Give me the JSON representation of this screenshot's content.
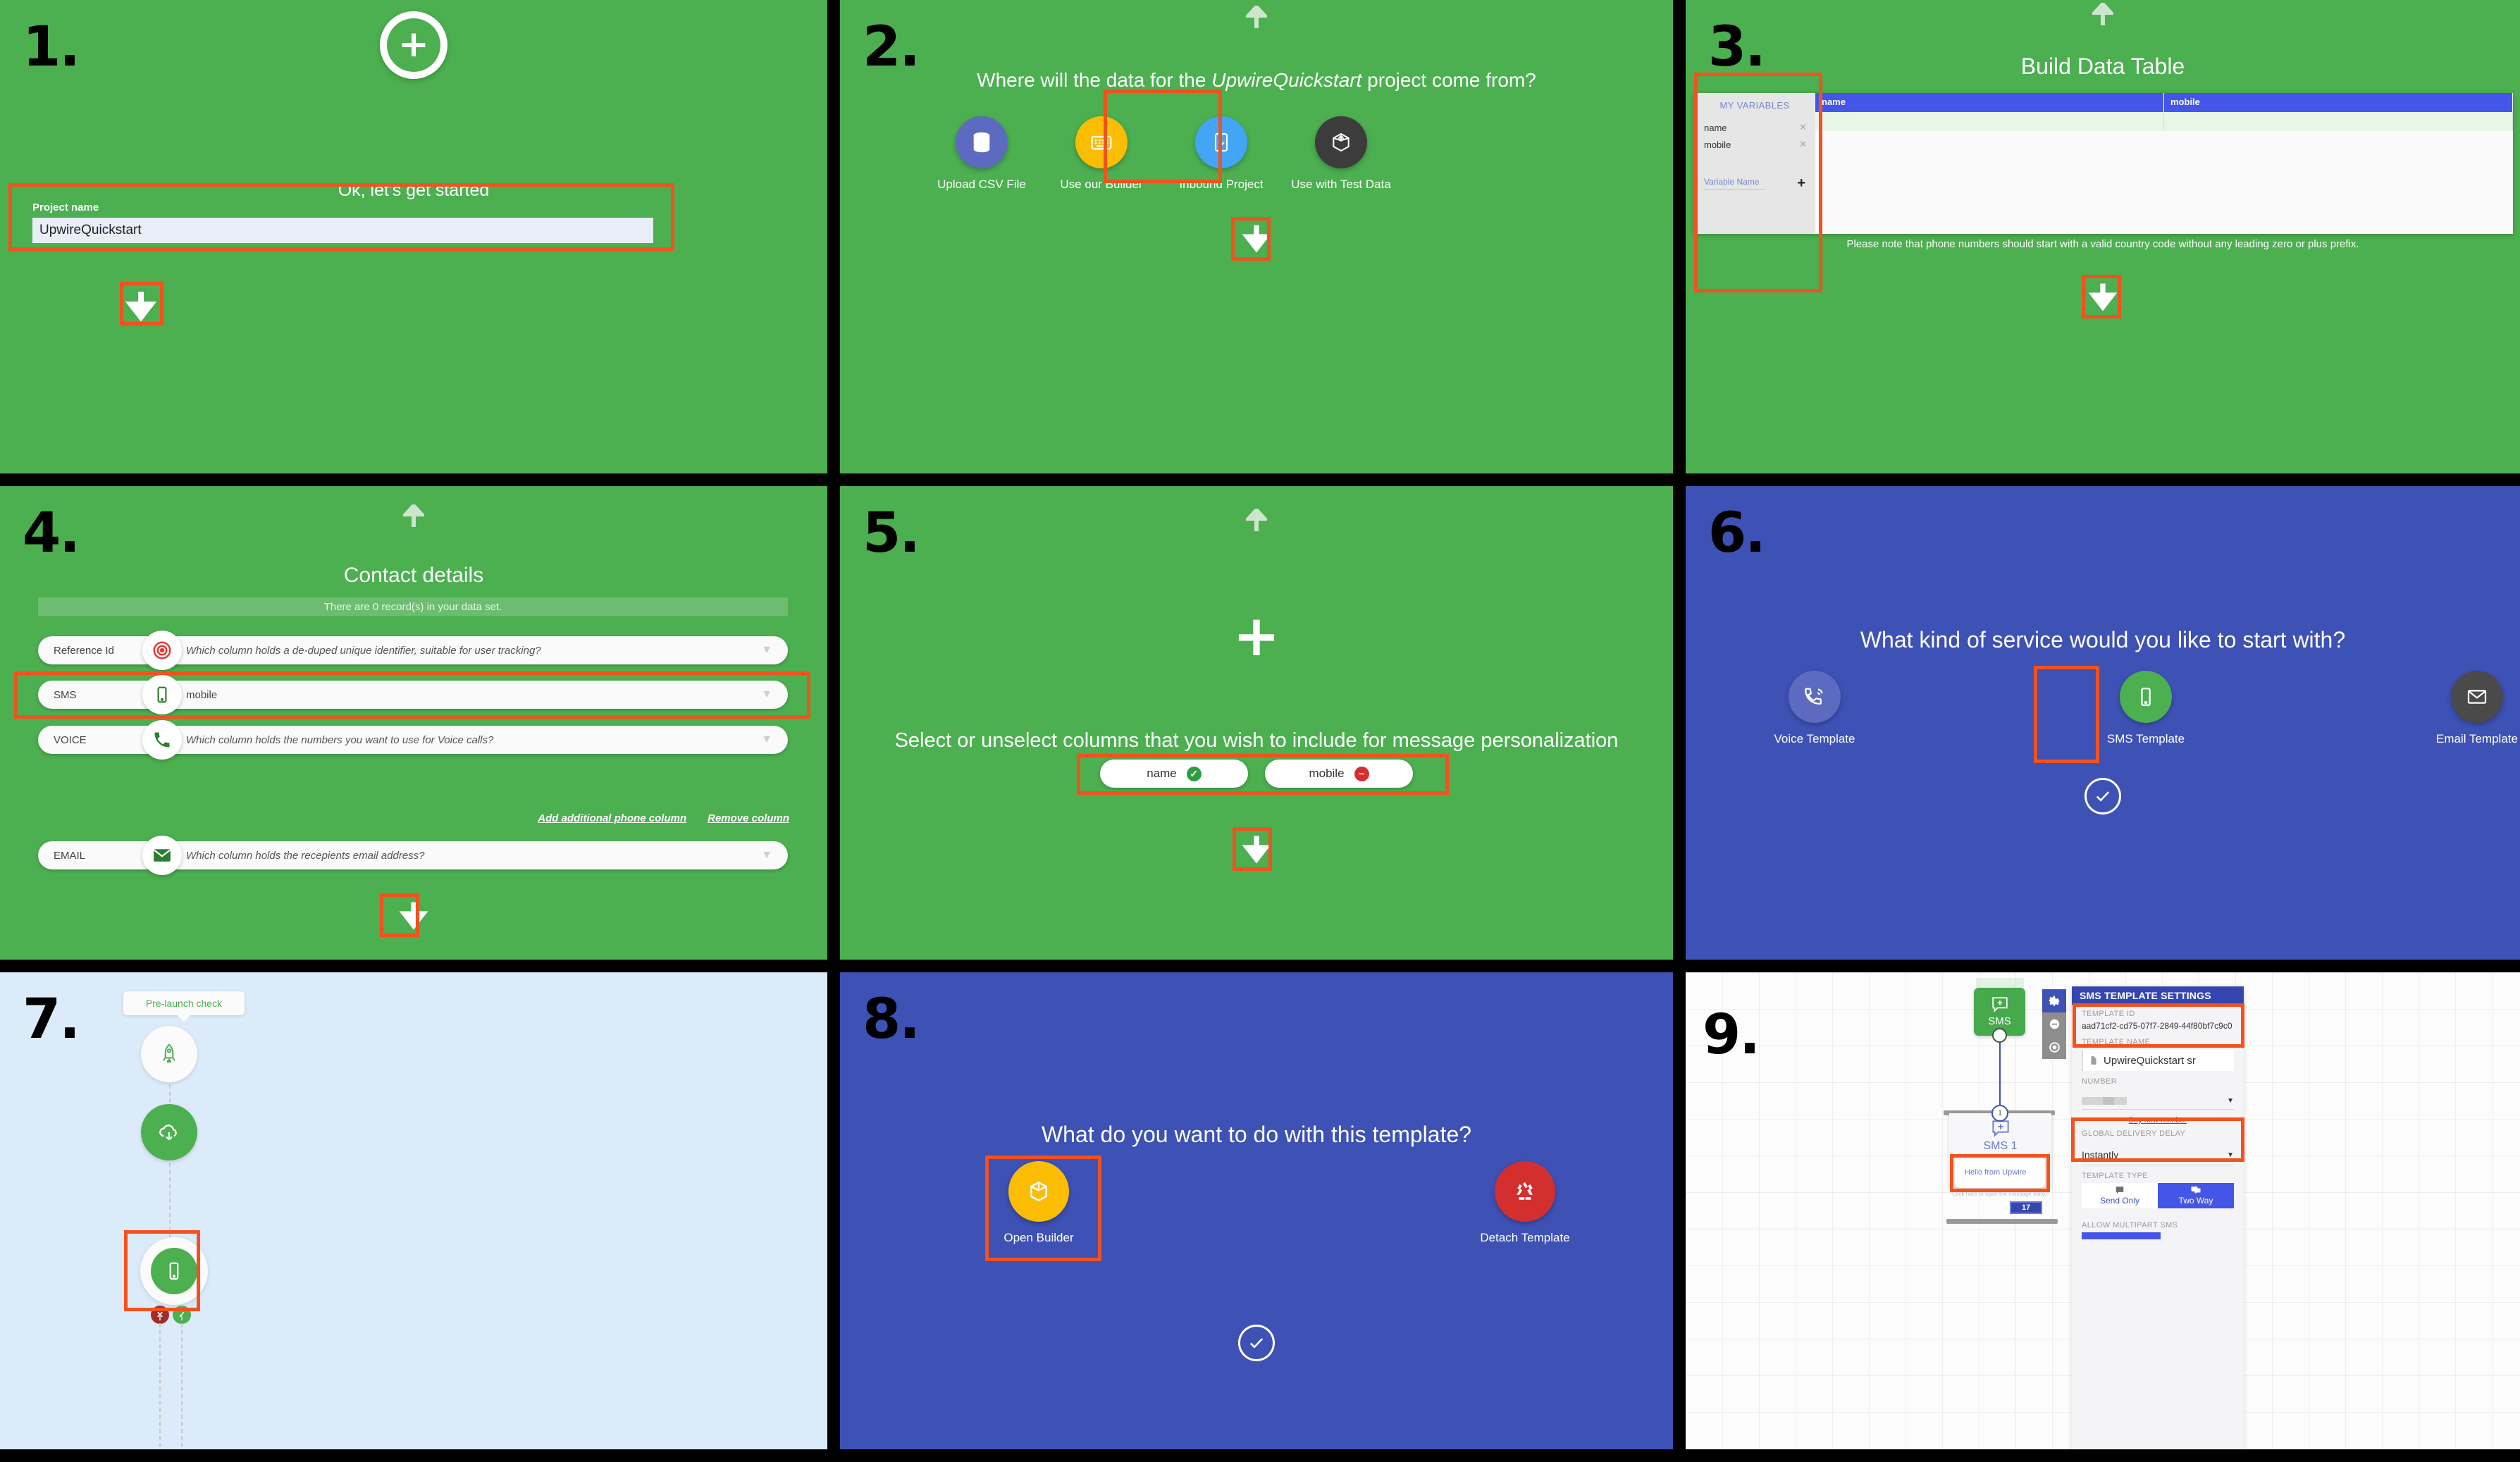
{
  "panels": {
    "p1": {
      "number": "1.",
      "title": "Ok, let's get started",
      "field_label": "Project name",
      "field_value": "UpwireQuickstart"
    },
    "p2": {
      "number": "2.",
      "question_pre": "Where will the data for the ",
      "question_em": "UpwireQuickstart",
      "question_post": " project come from?",
      "options": [
        {
          "label": "Upload CSV File",
          "icon": "database-icon",
          "color": "#5C6BC0"
        },
        {
          "label": "Use our Builder",
          "icon": "keyboard-icon",
          "color": "#FBBC04"
        },
        {
          "label": "Inbound Project",
          "icon": "inbound-download-icon",
          "color": "#42A5F5"
        },
        {
          "label": "Use with Test Data",
          "icon": "test-box-icon",
          "color": "#3C3C3C"
        }
      ]
    },
    "p3": {
      "number": "3.",
      "title": "Build Data Table",
      "variables_header": "MY VARIABLES",
      "variables": [
        "name",
        "mobile"
      ],
      "new_variable_placeholder": "Variable Name",
      "add_symbol": "+",
      "columns": [
        "name",
        "mobile"
      ],
      "note": "Please note that phone numbers should start with a valid country code without any leading zero or plus prefix."
    },
    "p4": {
      "number": "4.",
      "title": "Contact details",
      "record_banner": "There are 0 record(s) in your data set.",
      "rows": [
        {
          "key": "Reference Id",
          "value": "Which column holds a de-duped unique identifier, suitable for user tracking?",
          "icon": "target-icon",
          "solid": false
        },
        {
          "key": "SMS",
          "value": "mobile",
          "icon": "mobile-icon",
          "solid": true
        },
        {
          "key": "VOICE",
          "value": "Which column holds the numbers you want to use for Voice calls?",
          "icon": "phone-icon",
          "solid": false
        },
        {
          "key": "EMAIL",
          "value": "Which column holds the recepients email address?",
          "icon": "envelope-icon",
          "solid": false
        }
      ],
      "links": [
        "Add additional phone column",
        "Remove column"
      ]
    },
    "p5": {
      "number": "5.",
      "plus": "+",
      "instruction": "Select or unselect columns that you wish to include for message personalization",
      "chips": [
        {
          "label": "name",
          "state": "selected",
          "badge": "✓",
          "badge_color": "#2E9E44"
        },
        {
          "label": "mobile",
          "state": "unselected",
          "badge": "−",
          "badge_color": "#D32F2F"
        }
      ]
    },
    "p6": {
      "number": "6.",
      "question": "What kind of service would you like to start with?",
      "options": [
        {
          "label": "Voice Template",
          "icon": "voice-call-icon",
          "color": "#5C6BC0"
        },
        {
          "label": "SMS Template",
          "icon": "mobile-icon",
          "color": "#4CAF50"
        },
        {
          "label": "Email Template",
          "icon": "envelope-icon",
          "color": "#4A4A4A"
        }
      ],
      "confirm": "✓"
    },
    "p7": {
      "number": "7.",
      "tooltip": "Pre-launch check",
      "nodes": [
        {
          "name": "rocket-node",
          "icon": "rocket-icon"
        },
        {
          "name": "cloud-download-node",
          "icon": "cloud-download-icon"
        },
        {
          "name": "sms-node",
          "icon": "mobile-icon"
        }
      ],
      "branch_badges": [
        {
          "label": "✕",
          "color": "#A52A2A"
        },
        {
          "label": "✓",
          "color": "#4CAF50"
        }
      ]
    },
    "p8": {
      "number": "8.",
      "question": "What do you want to do with this template?",
      "options": [
        {
          "label": "Open Builder",
          "icon": "box-cube-icon",
          "color": "#FBBC04"
        },
        {
          "label": "Detach Template",
          "icon": "recycle-icon",
          "color": "#D32F2F"
        }
      ],
      "confirm": "✓"
    },
    "p9": {
      "number": "9.",
      "node_label": "SMS",
      "connector_number": "1",
      "card_label": "SMS 1",
      "message_text": "Hello from Upwire",
      "message_hint": "Click here to open the message editor.",
      "char_badge": "17",
      "tools": [
        {
          "name": "gear-icon",
          "glyph": "⚙",
          "active": true
        },
        {
          "name": "minus-circle-icon",
          "glyph": "⊖",
          "active": false
        },
        {
          "name": "record-circle-icon",
          "glyph": "◉",
          "active": false
        }
      ],
      "settings": {
        "header": "SMS TEMPLATE SETTINGS",
        "template_id_label": "TEMPLATE ID",
        "template_id_value": "aad71cf2-cd75-07f7-2849-44f80bf7c9c0",
        "template_name_label": "TEMPLATE NAME",
        "template_name_value": "UpwireQuickstart sr",
        "number_label": "NUMBER",
        "number_value": "",
        "buy_link": "Buy new number",
        "delay_label": "GLOBAL DELIVERY DELAY",
        "delay_value": "Instantly",
        "type_label": "TEMPLATE TYPE",
        "type_options": [
          {
            "label": "Send Only",
            "selected": false
          },
          {
            "label": "Two Way",
            "selected": true
          }
        ],
        "multipart_label": "ALLOW MULTIPART SMS"
      }
    }
  },
  "colors": {
    "green_bg": "#4CAF50",
    "blue_bg": "#3E51B5",
    "light_bg": "#DCEBFA",
    "highlight": "#F4511E",
    "table_header": "#4356E8"
  }
}
